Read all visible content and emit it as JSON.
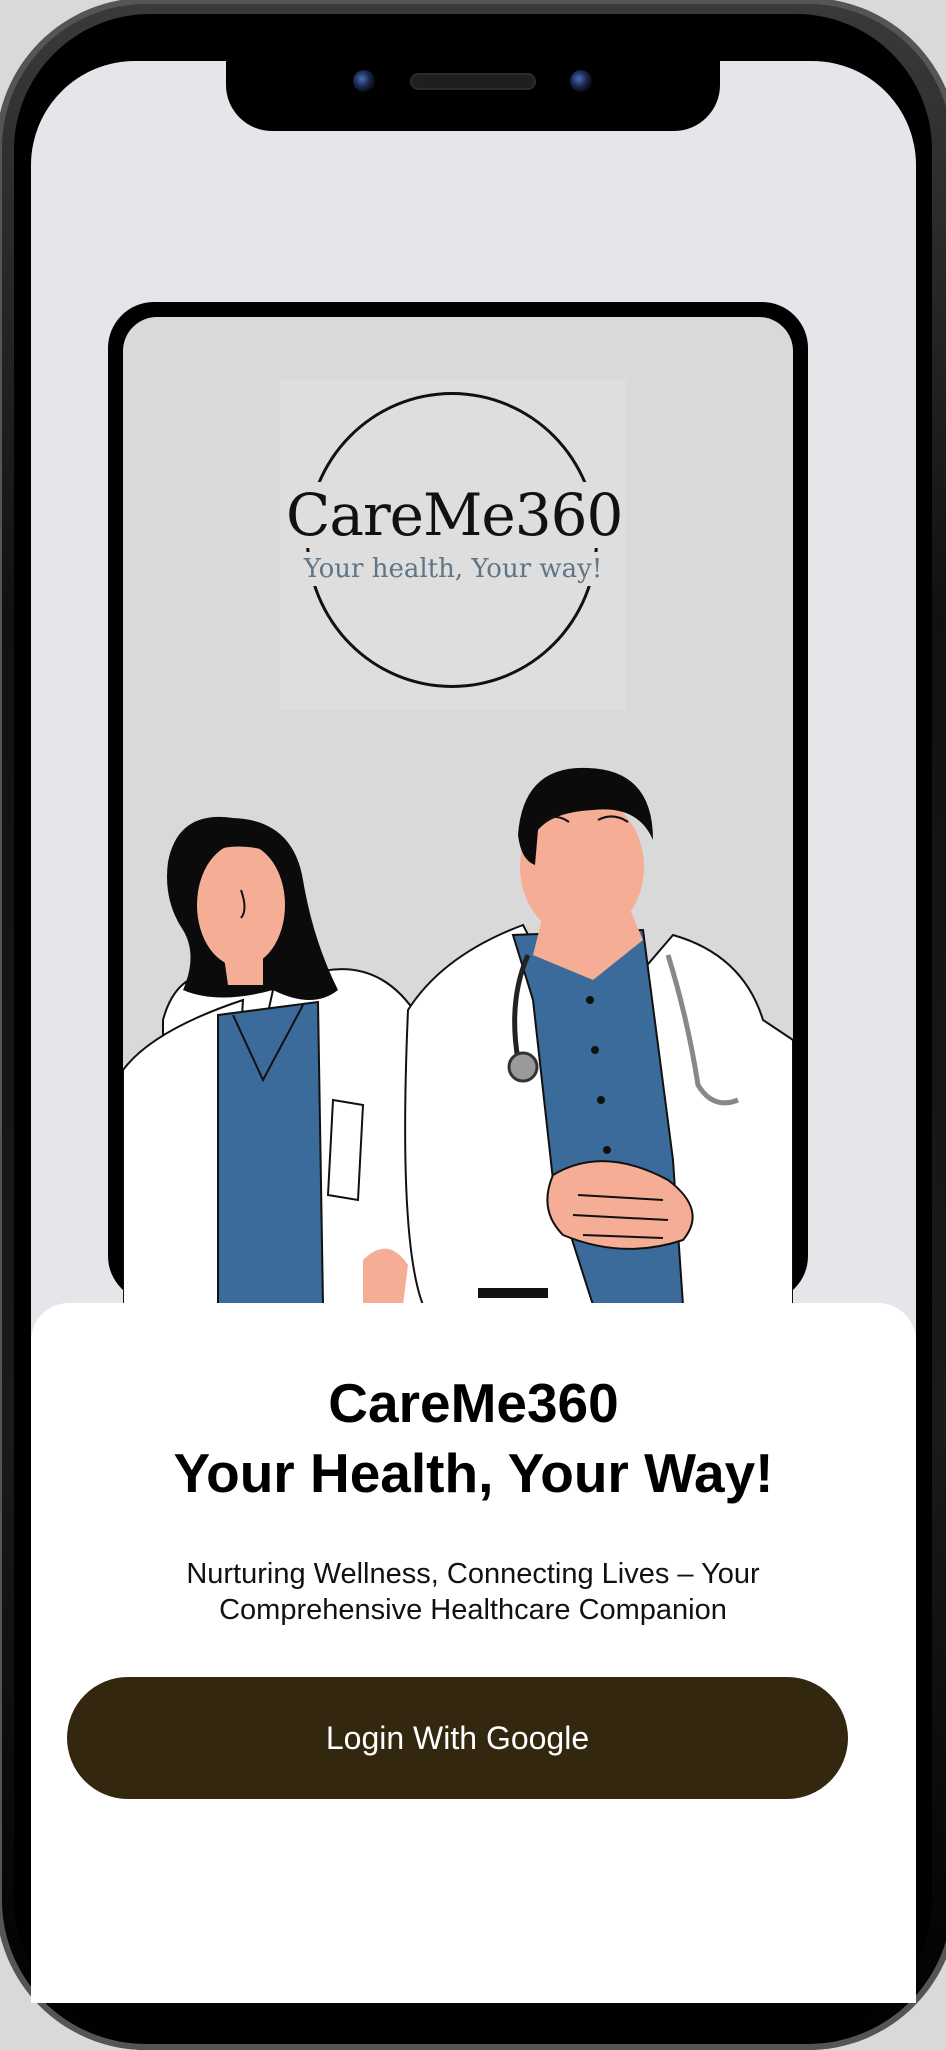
{
  "logo": {
    "title": "CareMe360",
    "tagline": "Your health, Your way!"
  },
  "sheet": {
    "headline_line1": "CareMe360",
    "headline_line2": "Your Health, Your Way!",
    "subtitle": "Nurturing Wellness, Connecting Lives – Your Comprehensive Healthcare Companion"
  },
  "actions": {
    "login_label": "Login With Google"
  },
  "colors": {
    "screen_bg": "#e4e6ea",
    "button_bg": "#33270f",
    "tagline": "#607585",
    "scrubs": "#3a6b9a",
    "skin": "#f6ad95"
  },
  "icons": [
    "stethoscope-icon"
  ]
}
